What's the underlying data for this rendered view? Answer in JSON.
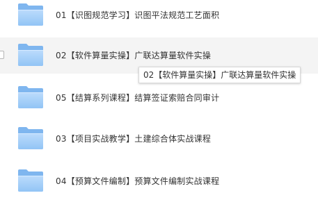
{
  "files": [
    {
      "name": "01【识图规范学习】识图平法规范工艺面积",
      "icon": "folder-icon",
      "hovered": false
    },
    {
      "name": "02【软件算量实操】广联达算量软件实操",
      "icon": "folder-icon",
      "hovered": true
    },
    {
      "name": "05【结算系列课程】结算签证索赔合同审计",
      "icon": "folder-icon",
      "hovered": false
    },
    {
      "name": "03【项目实战教学】土建综合体实战课程",
      "icon": "folder-icon",
      "hovered": false
    },
    {
      "name": "04【预算文件编制】预算文件编制实战课程",
      "icon": "folder-icon",
      "hovered": false
    }
  ],
  "tooltip": {
    "text": "02【软件算量实操】广联达算量软件实操"
  },
  "colors": {
    "folder_back": "#7fb6ef",
    "folder_front_top": "#bcdcfc",
    "folder_front_bottom": "#92c4f5",
    "hover_bg": "#f4f4f4"
  }
}
